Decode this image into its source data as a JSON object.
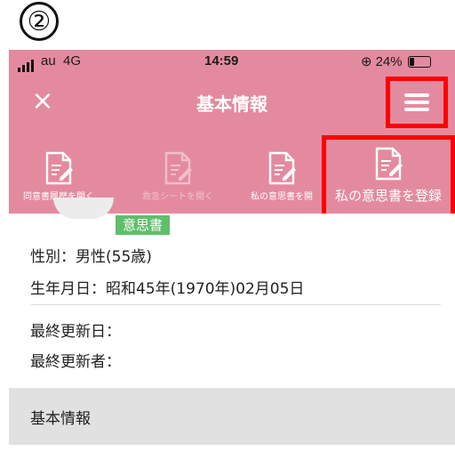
{
  "step_marker": "②",
  "status_bar": {
    "carrier": "au",
    "network": "4G",
    "time": "14:59",
    "battery_text": "24%",
    "battery_level": 0.24,
    "orientation_lock_icon": "orientation-lock-icon"
  },
  "navbar": {
    "close_label": "×",
    "title": "基本情報",
    "menu_icon": "hamburger-menu-icon"
  },
  "toolbar": {
    "items": [
      {
        "label": "同意書履歴を開く",
        "icon": "document-edit-icon",
        "enabled": true
      },
      {
        "label": "救急シートを開く",
        "icon": "document-edit-icon",
        "enabled": false
      },
      {
        "label": "私の意思書を開",
        "icon": "document-edit-icon",
        "enabled": true
      },
      {
        "label": "私の意思書を登録",
        "icon": "document-edit-icon",
        "enabled": true
      }
    ]
  },
  "profile": {
    "tag": "意思書",
    "gender": "性別：男性(55歳)",
    "birthdate": "生年月日：昭和45年(1970年)02月05日",
    "last_updated_date": "最終更新日：",
    "last_updated_by": "最終更新者："
  },
  "section": {
    "label": "基本情報"
  },
  "colors": {
    "header_pink": "#e48a9f",
    "highlight_red": "#ff0000",
    "tag_green": "#5fbf6b"
  }
}
